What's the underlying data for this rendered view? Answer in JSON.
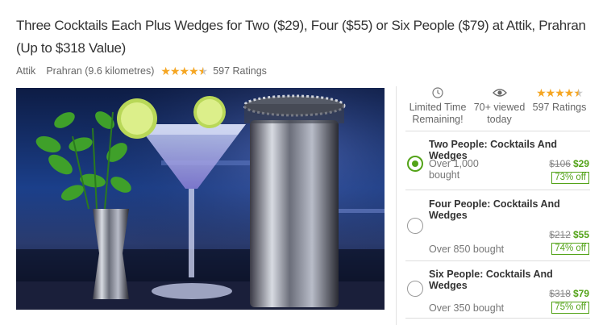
{
  "deal": {
    "title": "Three Cocktails Each Plus Wedges for Two ($29), Four ($55) or Six People ($79) at Attik, Prahran (Up to $318 Value)",
    "merchant": "Attik",
    "location": "Prahran (9.6 kilometres)",
    "rating_stars": 4.5,
    "ratings_label": "597 Ratings"
  },
  "stats": {
    "limited": {
      "icon": "clock-icon",
      "line1": "Limited Time",
      "line2": "Remaining!"
    },
    "viewed": {
      "icon": "eye-icon",
      "line1": "70+ viewed",
      "line2": "today"
    },
    "rating": {
      "rating_stars": 4.5,
      "label": "597 Ratings"
    }
  },
  "options": [
    {
      "title": "Two People: Cocktails And Wedges",
      "bought_line1": "Over 1,000",
      "bought_line2": "bought",
      "original": "$106",
      "price": "$29",
      "discount": "73% off",
      "selected": true
    },
    {
      "title": "Four People: Cocktails And Wedges",
      "bought_line1": "Over 850 bought",
      "original": "$212",
      "price": "$55",
      "discount": "74% off",
      "selected": false
    },
    {
      "title": "Six People: Cocktails And Wedges",
      "bought_line1": "Over 350 bought",
      "original": "$318",
      "price": "$79",
      "discount": "75% off",
      "selected": false
    }
  ],
  "colors": {
    "accent_green": "#53a318",
    "star_gold": "#f5a623"
  }
}
